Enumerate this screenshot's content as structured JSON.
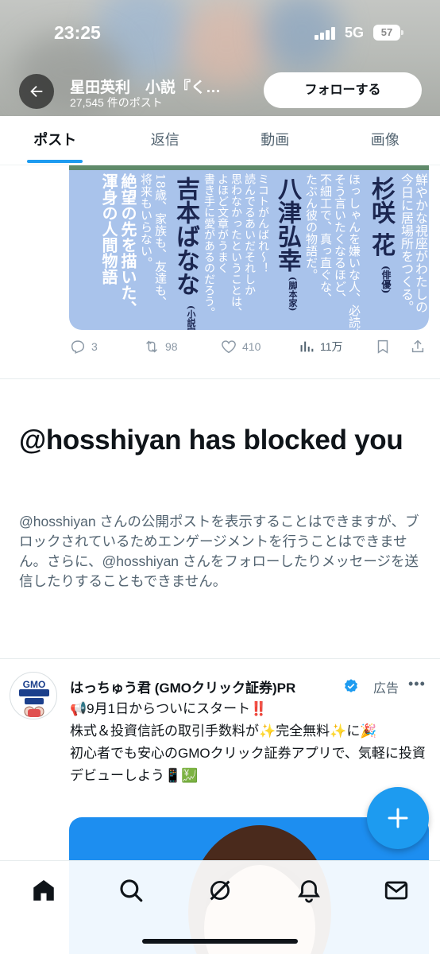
{
  "status_bar": {
    "time": "23:25",
    "network": "5G",
    "battery": "57"
  },
  "header": {
    "title": "星田英利　小説『く…",
    "post_count": "27,545 件のポスト",
    "follow_label": "フォローする"
  },
  "tabs": [
    {
      "label": "ポスト",
      "active": true
    },
    {
      "label": "返信"
    },
    {
      "label": "動画"
    },
    {
      "label": "画像"
    }
  ],
  "post": {
    "image_text": {
      "col1": "鮮やかな視座がわたしの",
      "col2": "今日に居場所をつくる。",
      "col3_name": "杉咲 花",
      "col3_role": "(俳優)",
      "col4": "ほっしゃんを嫌いな人、必読！",
      "col5": "そう言いたくなるほど、",
      "col6": "不細工で、真っ直ぐな、",
      "col7": "たぶん彼の物語だ。",
      "col8_name": "八津弘幸",
      "col8_role": "(脚本家)",
      "col9": "ミコトがんばれ〜！",
      "col10": "読んでるあいだそれしか",
      "col11": "思わなかったということは、",
      "col12": "よほど文章がうまく",
      "col13": "書き手に愛があるのだろう。",
      "col14_name": "吉本ばなな",
      "col14_role": "(小説家)",
      "col15": "18歳、家族も、友達も、",
      "col16": "将来もいらない。",
      "col17": "絶望の先を描いた、",
      "col18": "渾身の人間物語"
    },
    "replies": "3",
    "reposts": "98",
    "likes": "410",
    "views": "11万"
  },
  "blocked": {
    "title": "@hosshiyan has blocked you",
    "body": "@hosshiyan さんの公開ポストを表示することはできますが、ブロックされているためエンゲージメントを行うことはできません。さらに、@hosshiyan さんをフォローしたりメッセージを送信したりすることもできません。"
  },
  "ad": {
    "avatar_text": "GMO クリック 証券",
    "name": "はっちゅう君 (GMOクリック証券)PR",
    "label": "広告",
    "line1": "📢9月1日からついにスタート‼️",
    "line2": "株式＆投資信託の取引手数料が✨完全無料✨に🎉",
    "line3": "初心者でも安心のGMOクリック証券アプリで、気軽に投資デビューしよう📱💹"
  },
  "bottom_nav": [
    "home",
    "search",
    "grok",
    "notifications",
    "messages"
  ]
}
